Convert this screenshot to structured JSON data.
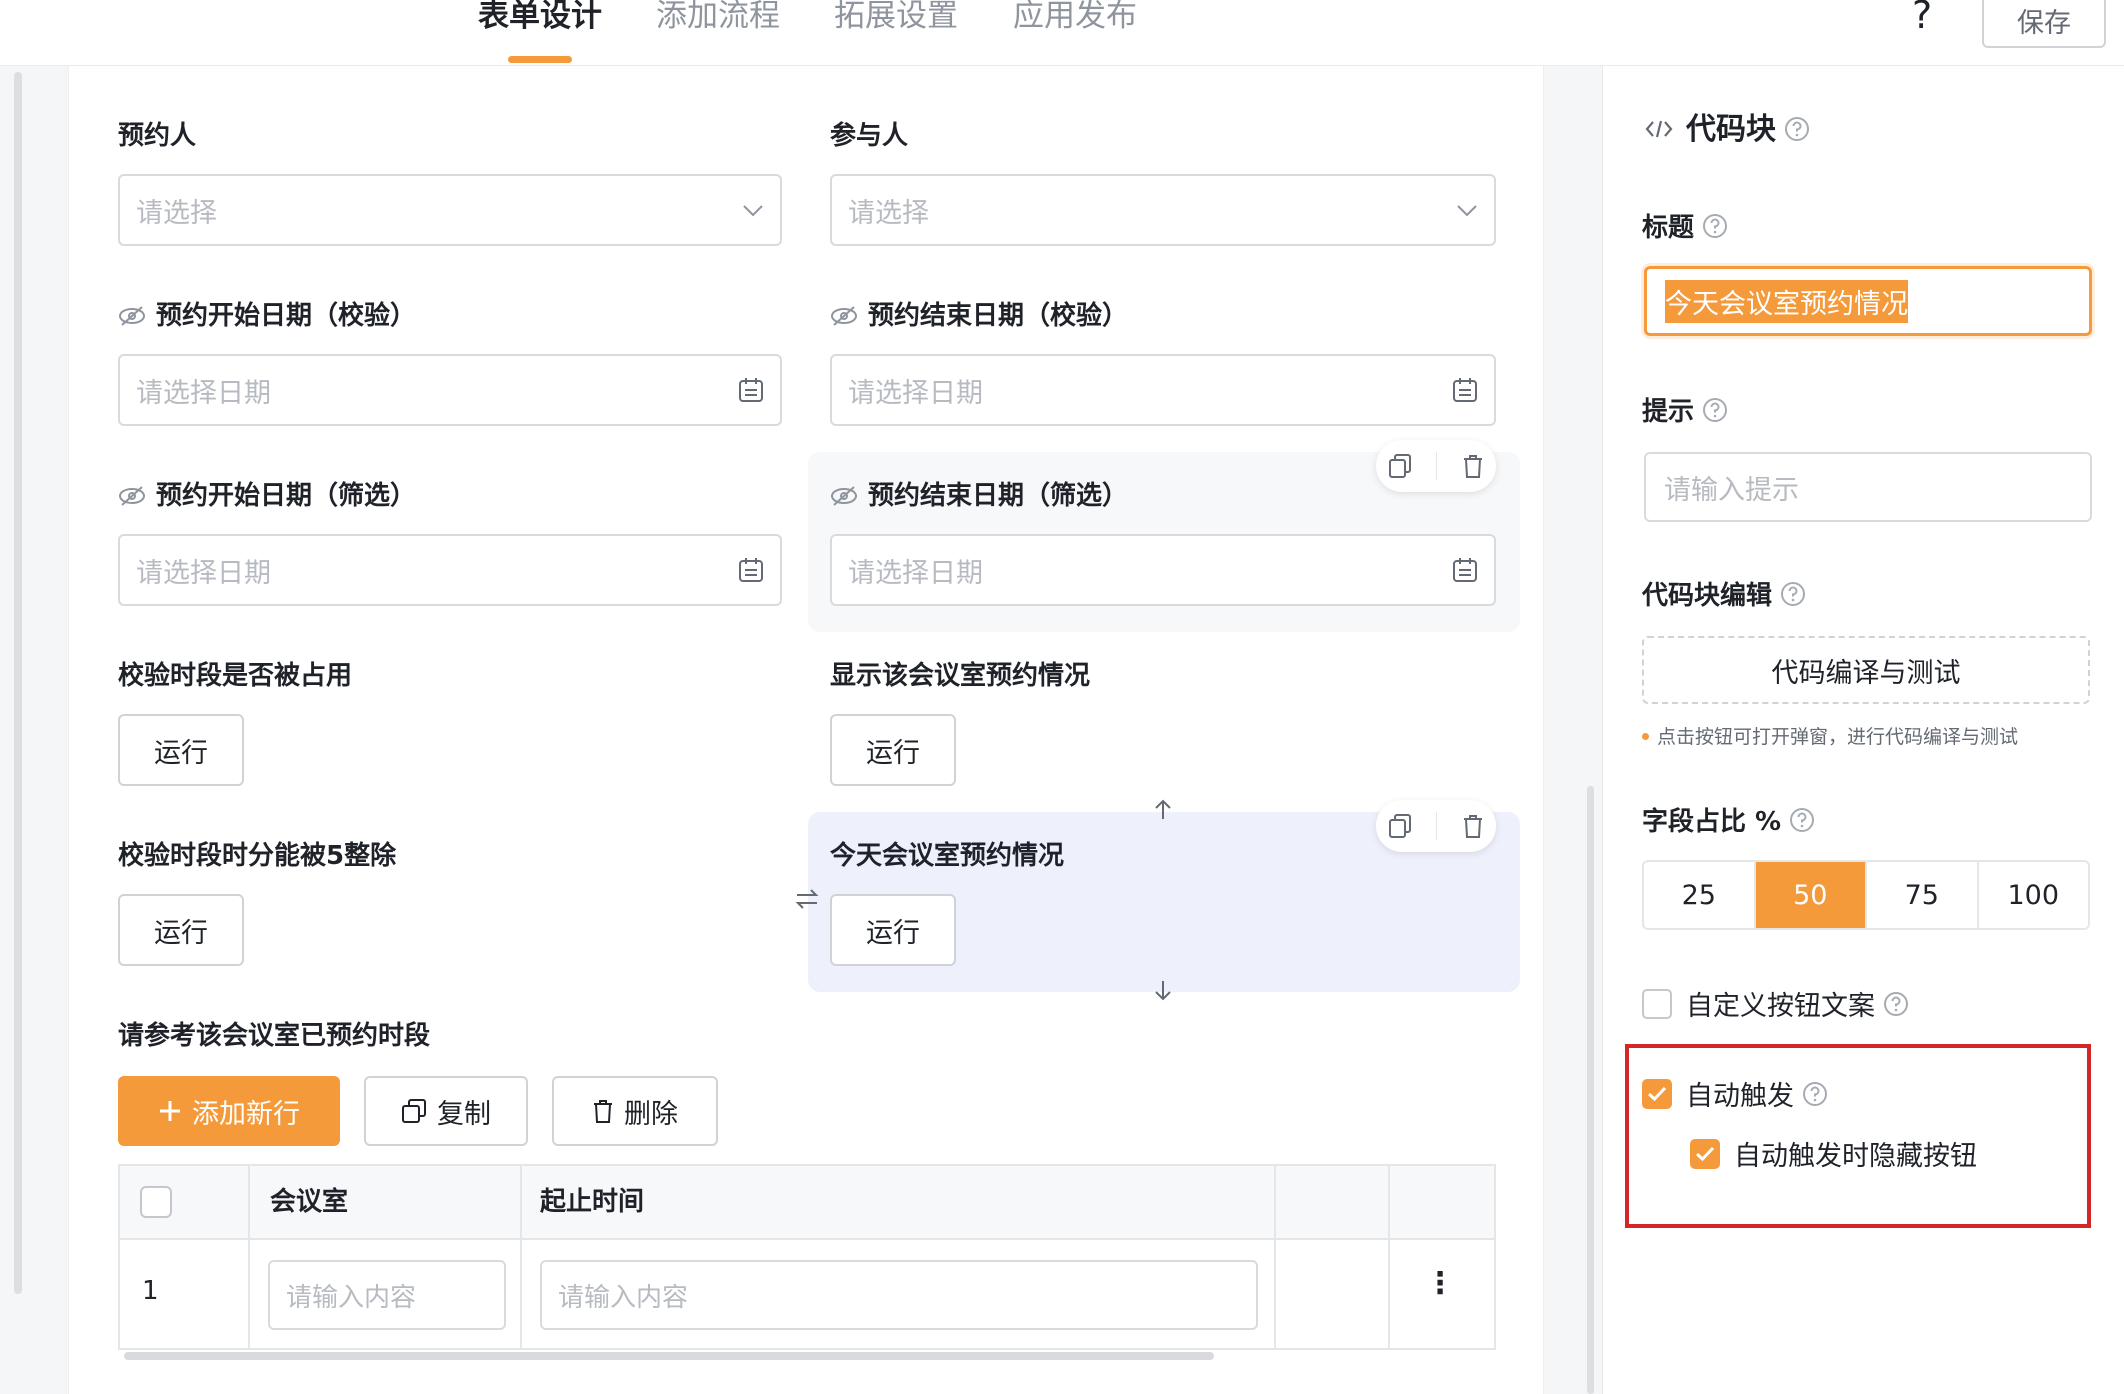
{
  "header": {
    "tabs": [
      "表单设计",
      "添加流程",
      "拓展设置",
      "应用发布"
    ],
    "active_tab": "表单设计",
    "help": "?",
    "save_label": "保存"
  },
  "form": {
    "booker": {
      "label": "预约人",
      "placeholder": "请选择"
    },
    "participants": {
      "label": "参与人",
      "placeholder": "请选择"
    },
    "start_date_check": {
      "label": "预约开始日期（校验）",
      "placeholder": "请选择日期"
    },
    "end_date_check": {
      "label": "预约结束日期（校验）",
      "placeholder": "请选择日期"
    },
    "start_date_filter": {
      "label": "预约开始日期（筛选）",
      "placeholder": "请选择日期"
    },
    "end_date_filter": {
      "label": "预约结束日期（筛选）",
      "placeholder": "请选择日期"
    },
    "check_occupied": {
      "label": "校验时段是否被占用",
      "button": "运行"
    },
    "show_room": {
      "label": "显示该会议室预约情况",
      "button": "运行"
    },
    "check_div5": {
      "label": "校验时段时分能被5整除",
      "button": "运行"
    },
    "today_room": {
      "label": "今天会议室预约情况",
      "button": "运行"
    },
    "subtable": {
      "label": "请参考该会议室已预约时段",
      "add_label": "添加新行",
      "copy_label": "复制",
      "delete_label": "删除",
      "columns": [
        "会议室",
        "起止时间"
      ],
      "rows": [
        {
          "index": "1",
          "room_placeholder": "请输入内容",
          "time_placeholder": "请输入内容"
        }
      ],
      "more": "⋮"
    }
  },
  "panel": {
    "title": "代码块",
    "title_field": {
      "label": "标题",
      "value": "今天会议室预约情况"
    },
    "hint_field": {
      "label": "提示",
      "placeholder": "请输入提示"
    },
    "code_edit": {
      "label": "代码块编辑",
      "button": "代码编译与测试",
      "hint": "点击按钮可打开弹窗，进行代码编译与测试"
    },
    "width_ratio": {
      "label": "字段占比 %",
      "options": [
        "25",
        "50",
        "75",
        "100"
      ],
      "selected": "50"
    },
    "custom_text": {
      "label": "自定义按钮文案",
      "checked": false
    },
    "auto_trigger": {
      "label": "自动触发",
      "checked": true
    },
    "hide_on_auto": {
      "label": "自动触发时隐藏按钮",
      "checked": true
    }
  },
  "colors": {
    "accent": "#f59a3b",
    "highlight_box": "#d42626",
    "selected_card": "#eef1fb"
  }
}
